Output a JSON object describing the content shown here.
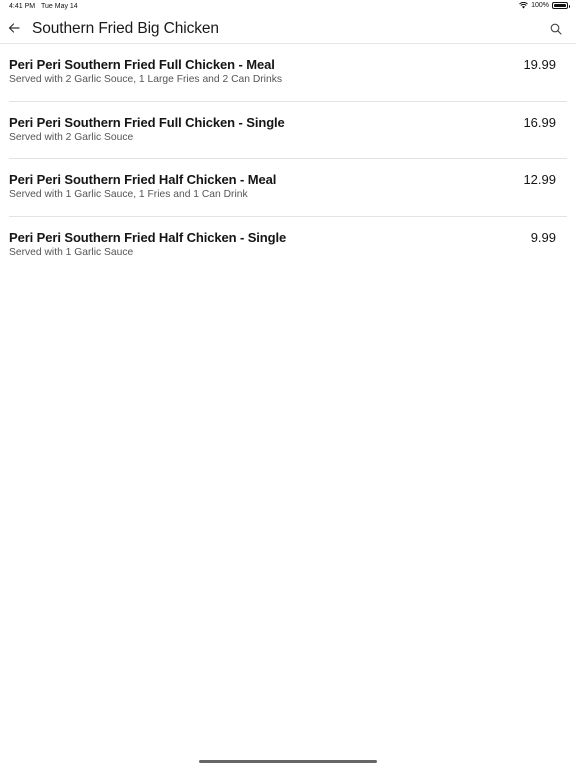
{
  "status_bar": {
    "time": "4:41 PM",
    "date": "Tue May 14",
    "battery": "100%",
    "battery_level": 1.0
  },
  "header": {
    "title": "Southern Fried Big Chicken",
    "back_icon": "arrow-left-icon",
    "search_icon": "search-icon"
  },
  "items": [
    {
      "name": "Peri Peri Southern Fried Full Chicken - Meal",
      "description": "Served with 2 Garlic Souce, 1 Large Fries and 2 Can Drinks",
      "price": "19.99"
    },
    {
      "name": "Peri Peri Southern Fried Full Chicken - Single",
      "description": "Served with 2 Garlic Souce",
      "price": "16.99"
    },
    {
      "name": "Peri Peri Southern Fried Half Chicken - Meal",
      "description": "Served with 1 Garlic Sauce, 1 Fries and 1 Can Drink",
      "price": "12.99"
    },
    {
      "name": "Peri Peri Southern Fried Half Chicken - Single",
      "description": "Served with 1 Garlic Sauce",
      "price": "9.99"
    }
  ]
}
